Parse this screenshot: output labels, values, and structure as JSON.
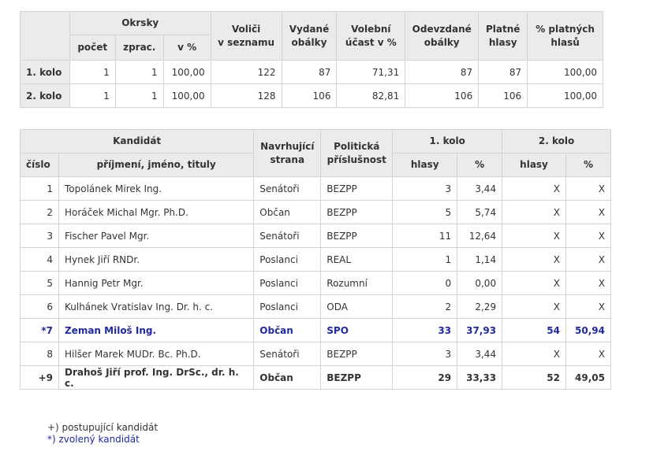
{
  "turnout_table": {
    "headers": {
      "okrsky": "Okrsky",
      "pocet": "počet",
      "zprac": "zprac.",
      "v_pct": "v %",
      "volici_line1": "Voliči",
      "volici_line2": "v seznamu",
      "vydane_line1": "Vydané",
      "vydane_line2": "obálky",
      "ucast_line1": "Volební",
      "ucast_line2": "účast v %",
      "odevzdane_line1": "Odevzdané",
      "odevzdane_line2": "obálky",
      "platne_line1": "Platné",
      "platne_line2": "hlasy",
      "pct_platnych_line1": "% platných",
      "pct_platnych_line2": "hlasů"
    },
    "rows": [
      {
        "label": "1. kolo",
        "pocet": "1",
        "zprac": "1",
        "v_pct": "100,00",
        "volici": "122",
        "vydane": "87",
        "ucast": "71,31",
        "odevzdane": "87",
        "platne": "87",
        "pct_platnych": "100,00"
      },
      {
        "label": "2. kolo",
        "pocet": "1",
        "zprac": "1",
        "v_pct": "100,00",
        "volici": "128",
        "vydane": "106",
        "ucast": "82,81",
        "odevzdane": "106",
        "platne": "106",
        "pct_platnych": "100,00"
      }
    ]
  },
  "candidate_table": {
    "headers": {
      "kandidat": "Kandidát",
      "cislo": "číslo",
      "jmeno": "příjmení, jméno, tituly",
      "navrhujici_line1": "Navrhující",
      "navrhujici_line2": "strana",
      "politicka_line1": "Politická",
      "politicka_line2": "příslušnost",
      "kolo1": "1. kolo",
      "kolo2": "2. kolo",
      "hlasy": "hlasy",
      "pct": "%"
    },
    "rows": [
      {
        "cislo": "1",
        "jmeno": "Topolánek Mirek Ing.",
        "strana": "Senátoři",
        "prislusnost": "BEZPP",
        "hlasy1": "3",
        "pct1": "3,44",
        "hlasy2": "X",
        "pct2": "X",
        "style": ""
      },
      {
        "cislo": "2",
        "jmeno": "Horáček Michal Mgr. Ph.D.",
        "strana": "Občan",
        "prislusnost": "BEZPP",
        "hlasy1": "5",
        "pct1": "5,74",
        "hlasy2": "X",
        "pct2": "X",
        "style": ""
      },
      {
        "cislo": "3",
        "jmeno": "Fischer Pavel Mgr.",
        "strana": "Senátoři",
        "prislusnost": "BEZPP",
        "hlasy1": "11",
        "pct1": "12,64",
        "hlasy2": "X",
        "pct2": "X",
        "style": ""
      },
      {
        "cislo": "4",
        "jmeno": "Hynek Jiří RNDr.",
        "strana": "Poslanci",
        "prislusnost": "REAL",
        "hlasy1": "1",
        "pct1": "1,14",
        "hlasy2": "X",
        "pct2": "X",
        "style": ""
      },
      {
        "cislo": "5",
        "jmeno": "Hannig Petr Mgr.",
        "strana": "Poslanci",
        "prislusnost": "Rozumní",
        "hlasy1": "0",
        "pct1": "0,00",
        "hlasy2": "X",
        "pct2": "X",
        "style": ""
      },
      {
        "cislo": "6",
        "jmeno": "Kulhánek Vratislav Ing. Dr. h. c.",
        "strana": "Poslanci",
        "prislusnost": "ODA",
        "hlasy1": "2",
        "pct1": "2,29",
        "hlasy2": "X",
        "pct2": "X",
        "style": ""
      },
      {
        "cislo": "*7",
        "jmeno": "Zeman Miloš Ing.",
        "strana": "Občan",
        "prislusnost": "SPO",
        "hlasy1": "33",
        "pct1": "37,93",
        "hlasy2": "54",
        "pct2": "50,94",
        "style": "hl"
      },
      {
        "cislo": "8",
        "jmeno": "Hilšer Marek MUDr. Bc. Ph.D.",
        "strana": "Senátoři",
        "prislusnost": "BEZPP",
        "hlasy1": "3",
        "pct1": "3,44",
        "hlasy2": "X",
        "pct2": "X",
        "style": ""
      },
      {
        "cislo": "+9",
        "jmeno": "Drahoš Jiří prof. Ing. DrSc., dr. h. c.",
        "strana": "Občan",
        "prislusnost": "BEZPP",
        "hlasy1": "29",
        "pct1": "33,33",
        "hlasy2": "52",
        "pct2": "49,05",
        "style": "adv"
      }
    ]
  },
  "legend": {
    "advancing": "+) postupující kandidát",
    "elected": "*) zvolený kandidát"
  },
  "colors": {
    "elected_text": "#1f2a9c",
    "header_bg": "#ebebeb",
    "border": "#d4d4d4"
  }
}
